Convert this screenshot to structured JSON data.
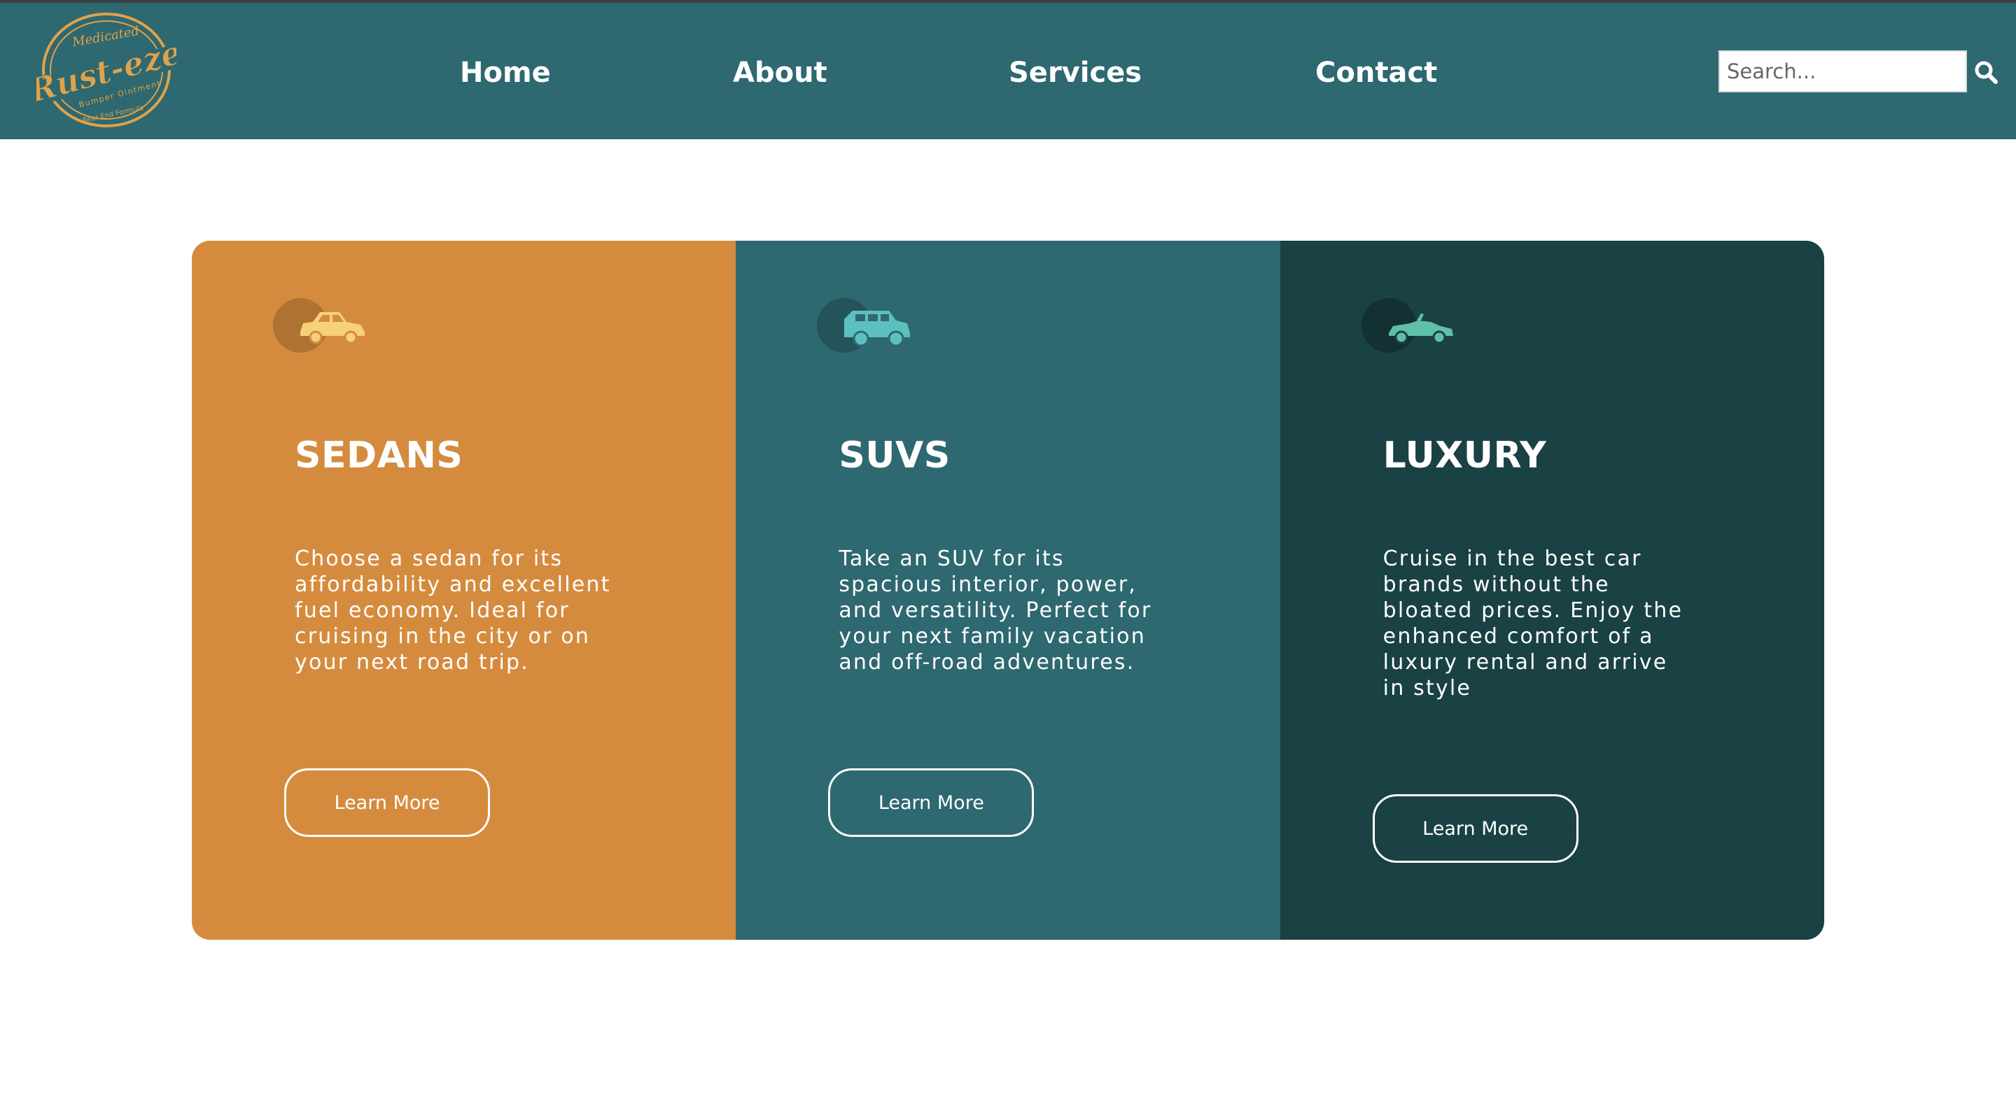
{
  "header": {
    "logo_text": "Rust-eze",
    "logo_small_top": "Medicated",
    "logo_small_mid": "Bumper Ointment",
    "logo_small_bottom": "Rear End Formula",
    "nav": [
      {
        "label": "Home"
      },
      {
        "label": "About"
      },
      {
        "label": "Services"
      },
      {
        "label": "Contact"
      }
    ],
    "search": {
      "placeholder": "Search...",
      "value": ""
    }
  },
  "cards": [
    {
      "title": "SEDANS",
      "text": "Choose a sedan for its affordability and excellent fuel economy. Ideal for cruising in the city or on your next road trip.",
      "button": "Learn More",
      "icon": "sedan-car-icon"
    },
    {
      "title": "SUVS",
      "text": "Take an SUV for its spacious interior, power, and versatility. Perfect for your next family vacation and off-road adventures.",
      "button": "Learn More",
      "icon": "suv-car-icon"
    },
    {
      "title": "LUXURY",
      "text": "Cruise in the best car brands without the bloated prices. Enjoy the enhanced comfort of a luxury rental and arrive in style",
      "button": "Learn More",
      "icon": "convertible-car-icon"
    }
  ],
  "colors": {
    "header_bg": "#2e6870",
    "sedans_bg": "#d58b3e",
    "suvs_bg": "#2e6870",
    "luxury_bg": "#1a4143",
    "logo_gold": "#e0a24a",
    "sedan_icon": "#f7d07a",
    "suv_icon": "#5cc0bf",
    "luxury_icon": "#5ec0a6"
  }
}
